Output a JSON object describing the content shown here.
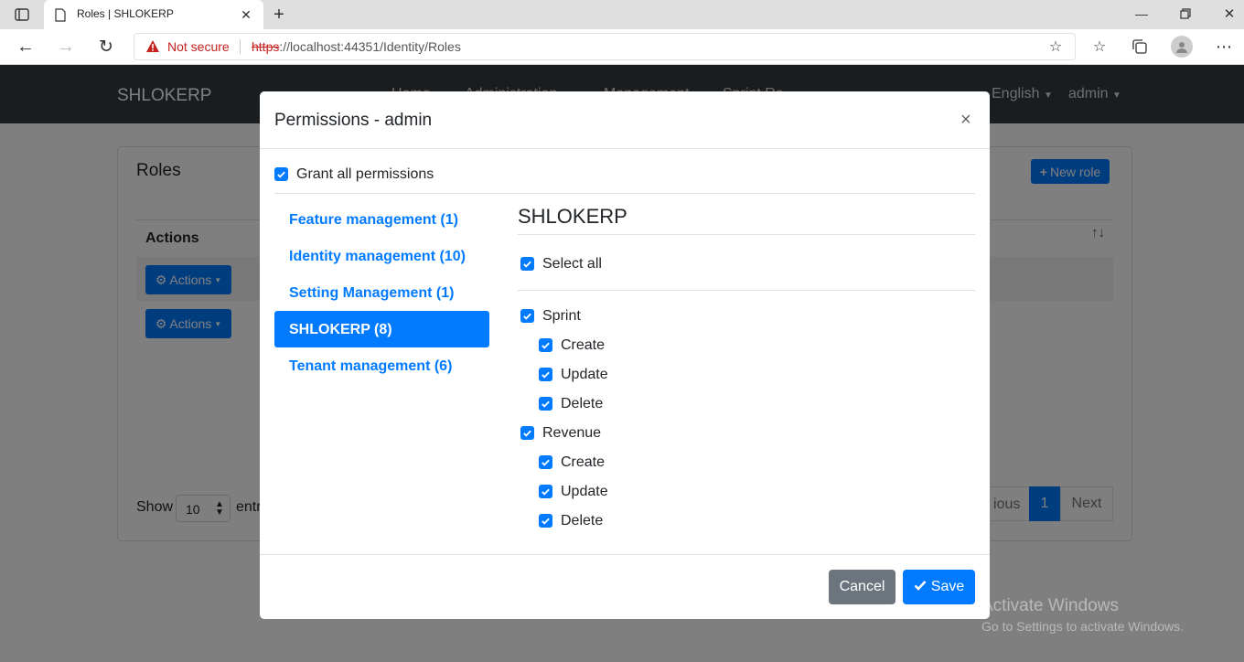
{
  "browser": {
    "tab_title": "Roles | SHLOKERP",
    "security_label": "Not secure",
    "url_scheme": "https",
    "url_rest": "://localhost:44351/Identity/Roles"
  },
  "app": {
    "brand": "SHLOKERP",
    "nav_home": "Home",
    "nav_administration": "Administration",
    "nav_management": "Management",
    "nav_sprint": "Sprint Re...",
    "language": "English",
    "user": "admin"
  },
  "roles_page": {
    "title": "Roles",
    "new_role_label": "New role",
    "column_actions": "Actions",
    "actions_label": "Actions",
    "show_label": "Show",
    "page_size": "10",
    "entries_label": "entr",
    "prev_label": "ious",
    "current_page": "1",
    "next_label": "Next"
  },
  "modal": {
    "title": "Permissions - admin",
    "grant_all_label": "Grant all permissions",
    "groups": [
      {
        "label": "Feature management (1)"
      },
      {
        "label": "Identity management (10)"
      },
      {
        "label": "Setting Management (1)"
      },
      {
        "label": "SHLOKERP (8)"
      },
      {
        "label": "Tenant management (6)"
      }
    ],
    "section_title": "SHLOKERP",
    "select_all_label": "Select all",
    "permissions": {
      "sprint": {
        "label": "Sprint",
        "create": "Create",
        "update": "Update",
        "delete": "Delete"
      },
      "revenue": {
        "label": "Revenue",
        "create": "Create",
        "update": "Update",
        "delete": "Delete"
      }
    },
    "cancel_label": "Cancel",
    "save_label": "Save"
  },
  "watermark": {
    "title": "Activate Windows",
    "subtitle": "Go to Settings to activate Windows."
  },
  "colors": {
    "primary": "#007bff",
    "navbar": "#343a40",
    "secondary": "#6c757d"
  }
}
